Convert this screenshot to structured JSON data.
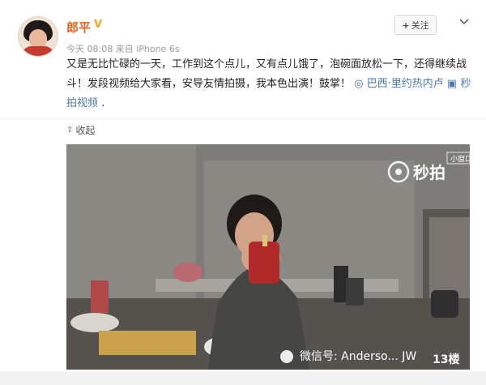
{
  "post": {
    "username": "郎平",
    "meta_time": "今天 08:08 来自 iPhone 6s",
    "follow_label": "关注",
    "text_main": "又是无比忙碌的一天，工作到这个点儿，又有点儿饿了，泡碗面放松一下，还得继续战斗！发段视频给大家看，安导友情拍摄，我本色出演！鼓掌！",
    "location": "巴西·里约热内卢",
    "video_link": "秒拍视频",
    "trailing": ".",
    "collapse_label": "收起"
  },
  "video": {
    "small_window_label": "小窗口",
    "miaopai_logo": "秒拍",
    "watermark": "微信号: Anderso... JW",
    "floor": "13楼"
  },
  "colors": {
    "username": "#e0651e",
    "link": "#4d79a8",
    "verified": "#f3a519"
  },
  "icons": [
    "verified-icon",
    "chevron-down-icon",
    "location-icon",
    "video-icon",
    "play-logo-icon",
    "wechat-icon"
  ]
}
